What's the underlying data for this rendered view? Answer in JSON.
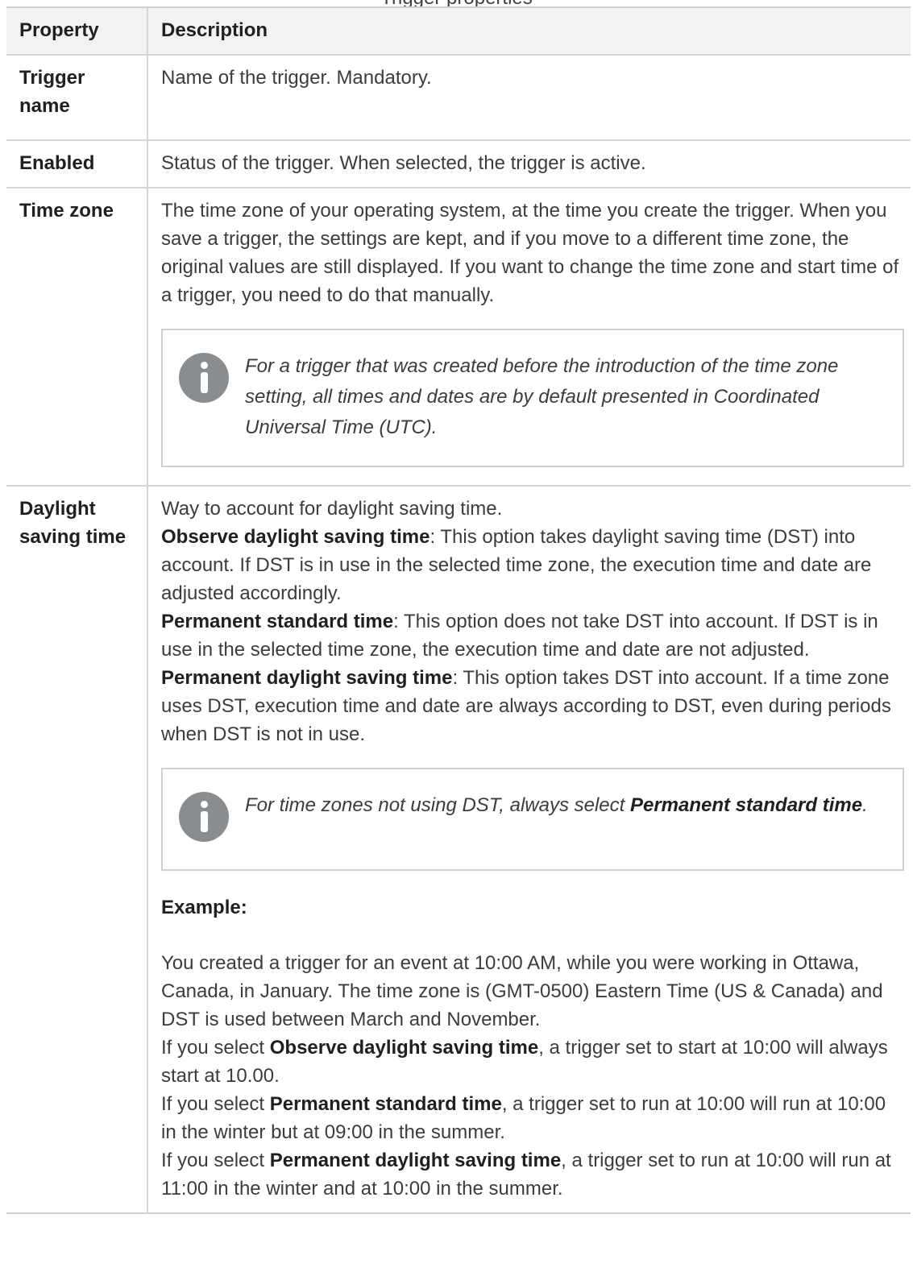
{
  "caption": "Trigger properties",
  "header": {
    "property": "Property",
    "description": "Description"
  },
  "rows": {
    "trigger_name": {
      "property": "Trigger name",
      "description": "Name of the trigger. Mandatory."
    },
    "enabled": {
      "property": "Enabled",
      "description": "Status of the trigger. When selected, the trigger is active."
    },
    "time_zone": {
      "property": "Time zone",
      "description": "The time zone of your operating system, at the time you create the trigger. When you save a trigger, the settings are kept, and if you move to a different time zone, the original values are still displayed. If you want to change the time zone and start time of a trigger, you need to do that manually.",
      "note": "For a trigger that was created before the introduction of the time zone setting, all times and dates are by default presented in Coordinated Universal Time (UTC)."
    },
    "dst": {
      "property": "Daylight saving time",
      "intro": "Way to account for daylight saving time.",
      "opt1_label": "Observe daylight saving time",
      "opt1_text": ": This option takes daylight saving time (DST) into account. If DST is in use in the selected time zone, the execution time and date are adjusted accordingly.",
      "opt2_label": "Permanent standard time",
      "opt2_text": ": This option does not take DST into account. If DST is in use in the selected time zone, the execution time and date are not adjusted.",
      "opt3_label": "Permanent daylight saving time",
      "opt3_text": ": This option takes DST into account. If a time zone uses DST, execution time and date are always according to DST, even during periods when DST is not in use.",
      "note_pre": "For time zones not using DST, always select ",
      "note_bold": "Permanent standard time",
      "note_post": ".",
      "example_heading": "Example:",
      "example_intro": "You created a trigger for an event at 10:00 AM, while you were working in Ottawa, Canada, in January. The time zone is (GMT-0500) Eastern Time (US & Canada) and DST is used between March and November.",
      "ex1_pre": "If you select ",
      "ex1_bold": "Observe daylight saving time",
      "ex1_post": ", a trigger set to start at 10:00 will always start at 10.00.",
      "ex2_pre": "If you select ",
      "ex2_bold": "Permanent standard time",
      "ex2_post": ", a trigger set to run at 10:00 will run at 10:00 in the winter but at 09:00 in the summer.",
      "ex3_pre": "If you select ",
      "ex3_bold": "Permanent daylight saving time",
      "ex3_post": ", a trigger set to run at 10:00 will run at 11:00 in the winter and at 10:00 in the summer."
    }
  },
  "icons": {
    "note": "info-icon"
  },
  "colors": {
    "header_bg": "#f2f2f2",
    "border": "#d6d6d6",
    "icon": "#8a8d90"
  }
}
